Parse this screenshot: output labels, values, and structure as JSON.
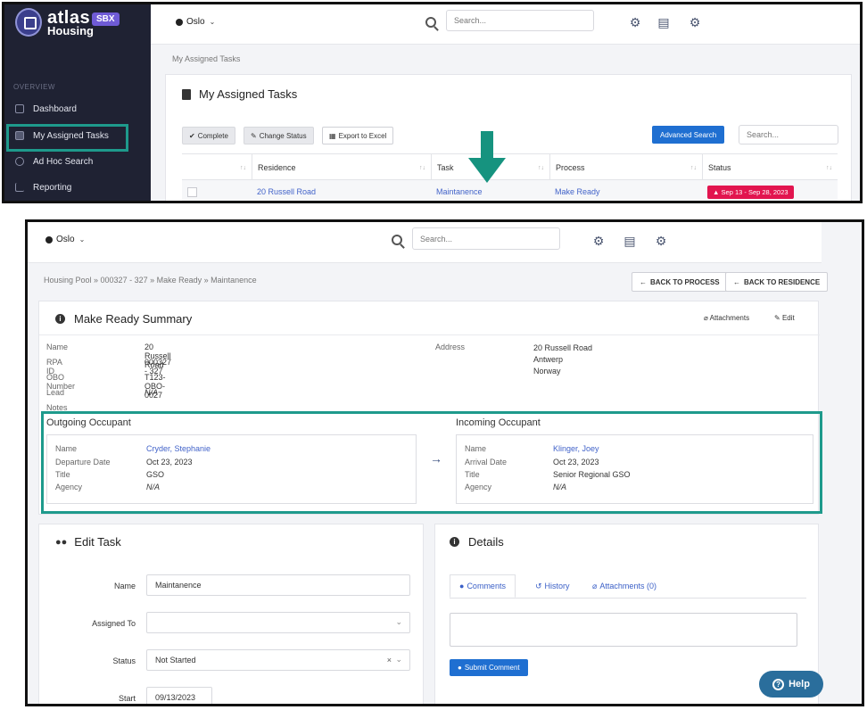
{
  "panel1": {
    "brand": {
      "name": "atlas",
      "sub": "Housing",
      "env": "SBX"
    },
    "sidebar": {
      "section": "OVERVIEW",
      "items": [
        {
          "label": "Dashboard"
        },
        {
          "label": "My Assigned Tasks"
        },
        {
          "label": "Ad Hoc Search"
        },
        {
          "label": "Reporting"
        }
      ]
    },
    "topbar": {
      "location": "Oslo",
      "search_placeholder": "Search..."
    },
    "breadcrumb": "My Assigned Tasks",
    "page_title": "My Assigned Tasks",
    "toolbar": {
      "complete": "Complete",
      "change_status": "Change Status",
      "export": "Export to Excel",
      "advanced_search": "Advanced Search",
      "search_placeholder": "Search..."
    },
    "table": {
      "columns": [
        "Residence",
        "Task",
        "Process",
        "Status"
      ],
      "rows": [
        {
          "residence": "20 Russell Road",
          "task": "Maintanence",
          "process": "Make Ready",
          "status": "Sep 13 - Sep 28, 2023"
        }
      ]
    },
    "colors": {
      "accent": "#1e9a8c",
      "status_red": "#e2154f",
      "primary": "#1f6fd1"
    }
  },
  "panel2": {
    "topbar": {
      "location": "Oslo",
      "search_placeholder": "Search..."
    },
    "breadcrumb": "Housing Pool » 000327 - 327 » Make Ready » Maintanence",
    "back_process": "BACK TO PROCESS",
    "back_residence": "BACK TO RESIDENCE",
    "summary": {
      "title": "Make Ready Summary",
      "attachments": "Attachments",
      "edit": "Edit",
      "fields": [
        {
          "label": "Name",
          "value": "20 Russell Road"
        },
        {
          "label": "RPA ID",
          "value": "000327 - 327"
        },
        {
          "label": "OBO Number",
          "value": "T123-OBO-0027"
        },
        {
          "label": "Lead",
          "value": "N/A"
        },
        {
          "label": "Notes",
          "value": ""
        }
      ],
      "address_label": "Address",
      "address_lines": [
        "20 Russell Road",
        "Antwerp",
        "Norway"
      ]
    },
    "outgoing": {
      "title": "Outgoing Occupant",
      "name_label": "Name",
      "name": "Cryder, Stephanie",
      "date_label": "Departure Date",
      "date": "Oct 23, 2023",
      "title_label": "Title",
      "role": "GSO",
      "agency_label": "Agency",
      "agency": "N/A"
    },
    "incoming": {
      "title": "Incoming Occupant",
      "name_label": "Name",
      "name": "Klinger, Joey",
      "date_label": "Arrival Date",
      "date": "Oct 23, 2023",
      "title_label": "Title",
      "role": "Senior Regional GSO",
      "agency_label": "Agency",
      "agency": "N/A"
    },
    "edit_task": {
      "title": "Edit Task",
      "name_label": "Name",
      "name_value": "Maintanence",
      "assigned_label": "Assigned To",
      "assigned_value": "",
      "status_label": "Status",
      "status_value": "Not Started",
      "start_label": "Start",
      "start_value": "09/13/2023"
    },
    "details": {
      "title": "Details",
      "tabs": [
        "Comments",
        "History",
        "Attachments (0)"
      ],
      "submit": "Submit Comment"
    },
    "help": "Help"
  }
}
